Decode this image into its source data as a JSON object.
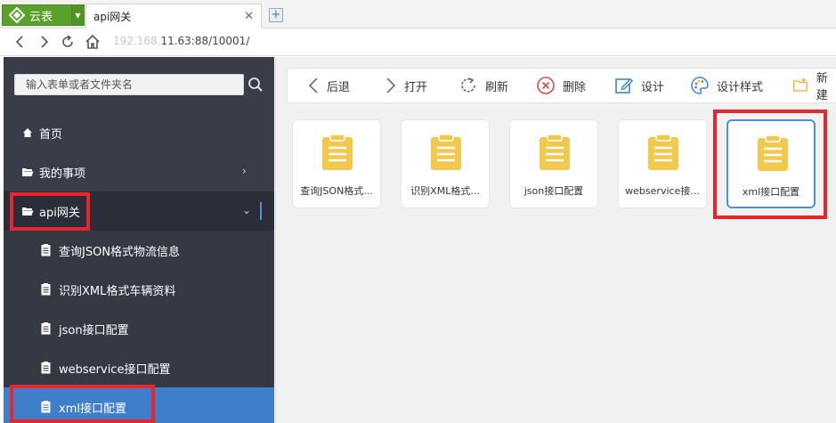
{
  "browser": {
    "brand_label": "云表",
    "tab_title": "api网关",
    "tab_close": "✕",
    "new_tab": "+",
    "address_prefix": "192.",
    "address_dim": "168.",
    "address_main": "11.63:88/10001/"
  },
  "sidebar": {
    "search_placeholder": "输入表单或者文件夹名",
    "items": [
      {
        "label": "首页",
        "icon": "home-icon"
      },
      {
        "label": "我的事项",
        "icon": "folder-open-icon",
        "arrow": "›"
      },
      {
        "label": "api网关",
        "icon": "folder-open-icon",
        "arrow": "⌄"
      }
    ],
    "sub_items": [
      {
        "label": "查询JSON格式物流信息"
      },
      {
        "label": "识别XML格式车辆资料"
      },
      {
        "label": "json接口配置"
      },
      {
        "label": "webservice接口配置"
      },
      {
        "label": "xml接口配置"
      }
    ]
  },
  "toolbar": {
    "back": "后退",
    "open": "打开",
    "refresh": "刷新",
    "delete": "删除",
    "design": "设计",
    "design_style": "设计样式",
    "new": "新建"
  },
  "files": [
    {
      "name": "查询JSON格式..."
    },
    {
      "name": "识别XML格式..."
    },
    {
      "name": "json接口配置"
    },
    {
      "name": "webservice接..."
    },
    {
      "name": "xml接口配置"
    }
  ],
  "colors": {
    "brand_green": "#5aa12a",
    "sidebar_bg": "#393d49",
    "selected_blue": "#3f7fc9",
    "doc_yellow": "#f2c94c",
    "highlight_red": "#e8242c"
  }
}
